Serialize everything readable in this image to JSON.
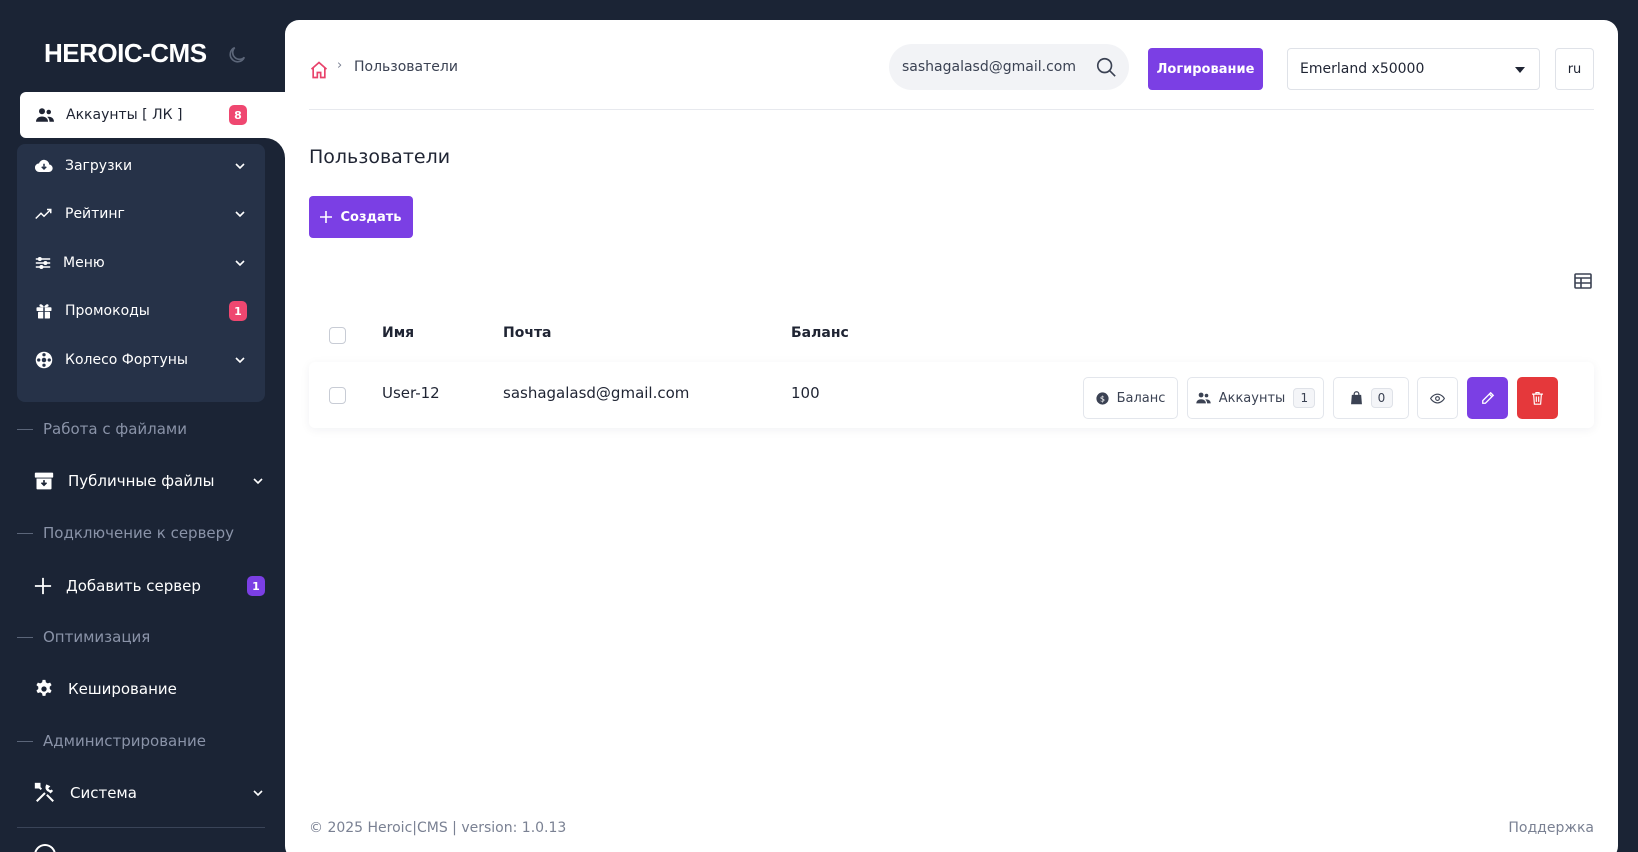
{
  "app": {
    "brand": "HEROIC-CMS"
  },
  "sidebar": {
    "active_item": {
      "label": "Аккаунты [ ЛК ]",
      "badge": "8",
      "icon": "users-icon"
    },
    "group_items": [
      {
        "label": "Загрузки",
        "icon": "cloud-download-icon",
        "has_chevron": true
      },
      {
        "label": "Рейтинг",
        "icon": "trending-icon",
        "has_chevron": true
      },
      {
        "label": "Меню",
        "icon": "sliders-icon",
        "has_chevron": true
      },
      {
        "label": "Промокоды",
        "icon": "gift-icon",
        "badge": "1"
      },
      {
        "label": "Колесо Фортуны",
        "icon": "wheel-icon",
        "has_chevron": true
      }
    ],
    "sections": [
      {
        "title": "Работа с файлами"
      },
      {
        "title": "Подключение к серверу"
      },
      {
        "title": "Оптимизация"
      },
      {
        "title": "Администрирование"
      }
    ],
    "links": [
      {
        "label": "Публичные файлы",
        "icon": "archive-icon",
        "has_chevron": true
      },
      {
        "label": "Добавить сервер",
        "icon": "plus-icon",
        "badge": "1"
      },
      {
        "label": "Кеширование",
        "icon": "gear-icon"
      },
      {
        "label": "Система",
        "icon": "tools-icon",
        "has_chevron": true
      }
    ]
  },
  "header": {
    "breadcrumb": "Пользователи",
    "search_value": "sashagalasd@gmail.com",
    "log_button": "Логирование",
    "server_select": "Emerland x50000",
    "language": "ru"
  },
  "page": {
    "title": "Пользователи",
    "create_button": "Создать"
  },
  "table": {
    "columns": [
      "Имя",
      "Почта",
      "Баланс"
    ],
    "rows": [
      {
        "name": "User-12",
        "email": "sashagalasd@gmail.com",
        "balance": "100",
        "balance_button": "Баланс",
        "accounts_button": "Аккаунты",
        "accounts_count": "1",
        "bag_count": "0"
      }
    ]
  },
  "footer": {
    "copyright": "© 2025 Heroic|CMS | version: 1.0.13",
    "support": "Поддержка"
  },
  "colors": {
    "sidebar_bg": "#1b2435",
    "accent": "#7b3fe4",
    "danger": "#e5383b",
    "badge_red": "#ef4770"
  }
}
